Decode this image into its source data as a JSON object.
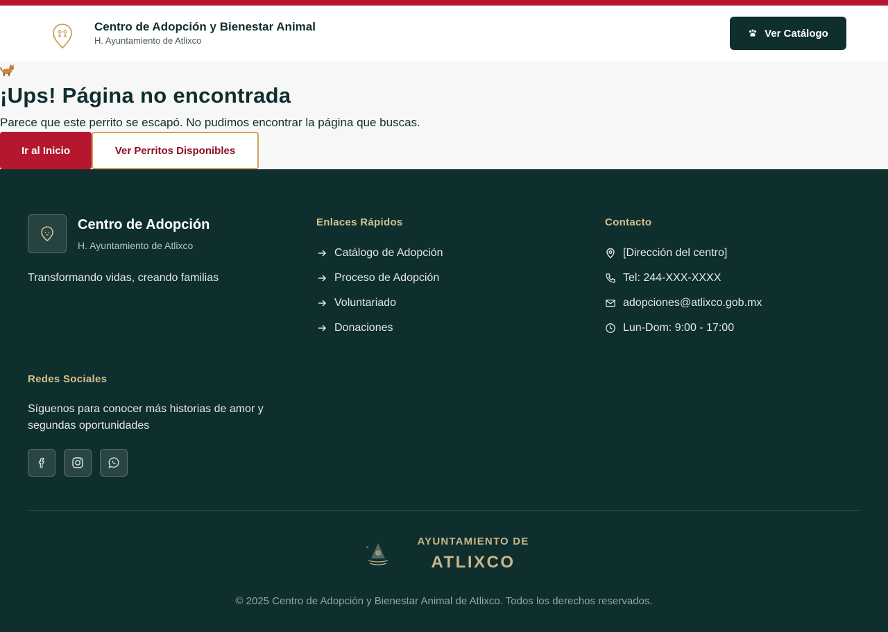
{
  "colors": {
    "brand_red": "#b5172f",
    "dark_teal": "#0f2e2e",
    "gold": "#d6c18e",
    "accent_border": "#d4a35c"
  },
  "header": {
    "title": "Centro de Adopción y Bienestar Animal",
    "subtitle": "H. Ayuntamiento de Atlixco",
    "logo_icon": "location-pin-icon",
    "catalog_button": {
      "label": "Ver Catálogo",
      "icon": "paw-icon"
    }
  },
  "main": {
    "emoji_icon": "dog-emoji",
    "title": "¡Ups! Página no encontrada",
    "message": "Parece que este perrito se escapó. No pudimos encontrar la página que buscas.",
    "primary_button": "Ir al Inicio",
    "secondary_button": "Ver Perritos Disponibles"
  },
  "footer": {
    "brand": {
      "title": "Centro de Adopción",
      "subtitle": "H. Ayuntamiento de Atlixco",
      "tagline": "Transformando vidas, creando familias",
      "icon": "heart-pin-icon"
    },
    "quick_links": {
      "heading": "Enlaces Rápidos",
      "items": [
        {
          "label": "Catálogo de Adopción",
          "icon": "arrow-right-icon"
        },
        {
          "label": "Proceso de Adopción",
          "icon": "arrow-right-icon"
        },
        {
          "label": "Voluntariado",
          "icon": "arrow-right-icon"
        },
        {
          "label": "Donaciones",
          "icon": "arrow-right-icon"
        }
      ]
    },
    "contact": {
      "heading": "Contacto",
      "items": [
        {
          "label": "[Dirección del centro]",
          "icon": "map-pin-icon"
        },
        {
          "label": "Tel: 244-XXX-XXXX",
          "icon": "phone-icon"
        },
        {
          "label": "adopciones@atlixco.gob.mx",
          "icon": "mail-icon"
        },
        {
          "label": "Lun-Dom: 9:00 - 17:00",
          "icon": "clock-icon"
        }
      ]
    },
    "social": {
      "heading": "Redes Sociales",
      "text": "Síguenos para conocer más historias de amor y segundas oportunidades",
      "icons": [
        "facebook-icon",
        "instagram-icon",
        "whatsapp-icon"
      ]
    },
    "ayuntamiento": {
      "line1": "AYUNTAMIENTO DE",
      "line2": "ATLIXCO"
    },
    "copyright": "© 2025 Centro de Adopción y Bienestar Animal de Atlixco. Todos los derechos reservados."
  }
}
